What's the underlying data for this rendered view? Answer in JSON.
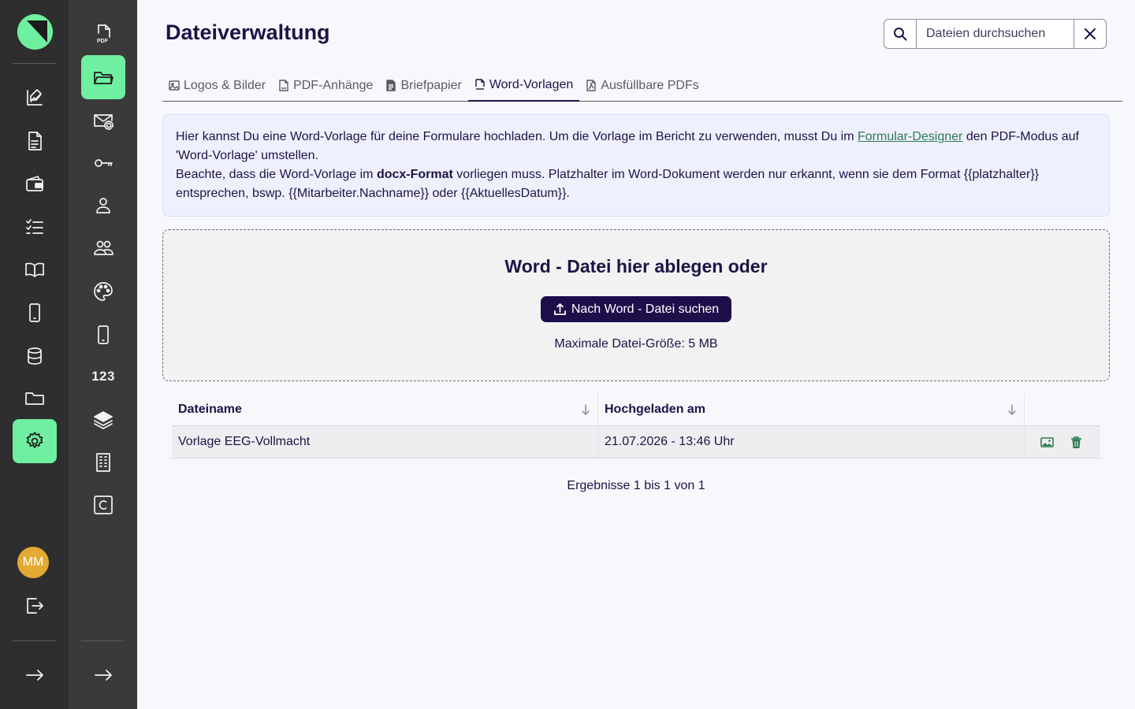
{
  "app": {
    "page_title": "Dateiverwaltung",
    "user_initials": "MM"
  },
  "search": {
    "placeholder": "Dateien durchsuchen"
  },
  "tabs": [
    {
      "label": "Logos & Bilder",
      "icon": "image-icon",
      "active": false
    },
    {
      "label": "PDF-Anhänge",
      "icon": "pdf-file-icon",
      "active": false
    },
    {
      "label": "Briefpapier",
      "icon": "document-icon",
      "active": false
    },
    {
      "label": "Word-Vorlagen",
      "icon": "docx-file-icon",
      "active": true
    },
    {
      "label": "Ausfüllbare PDFs",
      "icon": "pdf-form-icon",
      "active": false
    }
  ],
  "info": {
    "line1_pre": "Hier kannst Du eine Word-Vorlage für deine Formulare hochladen. Um die Vorlage im Bericht zu verwenden, musst Du im ",
    "link": "Formular-Designer",
    "line1_post": " den PDF-Modus auf 'Word-Vorlage' umstellen.",
    "line2_pre": "Beachte, dass die Word-Vorlage im ",
    "line2_bold": "docx-Format",
    "line2_post": " vorliegen muss. Platzhalter im Word-Dokument werden nur erkannt, wenn sie dem Format {{platzhalter}} entsprechen, bswp. {{Mitarbeiter.Nachname}} oder {{AktuellesDatum}}."
  },
  "dropzone": {
    "title": "Word - Datei hier ablegen oder",
    "button": "Nach Word - Datei suchen",
    "max_size": "Maximale Datei-Größe: 5 MB"
  },
  "table": {
    "headers": [
      "Dateiname",
      "Hochgeladen am",
      ""
    ],
    "rows": [
      {
        "name": "Vorlage EEG-Vollmacht",
        "uploaded": "21.07.2026 - 13:46 Uhr"
      }
    ],
    "results": "Ergebnisse 1 bis 1 von 1"
  },
  "colors": {
    "accent_green": "#6ef0a0",
    "primary_dark": "#1d0f4a",
    "rail_dark": "#2e2e2e",
    "rail_mid": "#3a3a3a",
    "avatar": "#e4a932",
    "link_green": "#2e7a4e"
  },
  "rail1_icons": [
    "edit-chart-icon",
    "report-icon",
    "wallet-icon",
    "checklist-icon",
    "book-icon",
    "phone-icon",
    "database-icon",
    "folder-icon",
    "gear-icon",
    "logout-icon",
    "arrow-right-icon"
  ],
  "rail2_icons": [
    "pdf-icon",
    "folder-open-icon",
    "mail-at-icon",
    "key-icon",
    "user-icon",
    "users-icon",
    "palette-icon",
    "mobile-icon",
    "numbers-icon",
    "layers-icon",
    "building-icon",
    "c-box-icon",
    "arrow-right-icon"
  ],
  "rail2_numbers_label": "123"
}
